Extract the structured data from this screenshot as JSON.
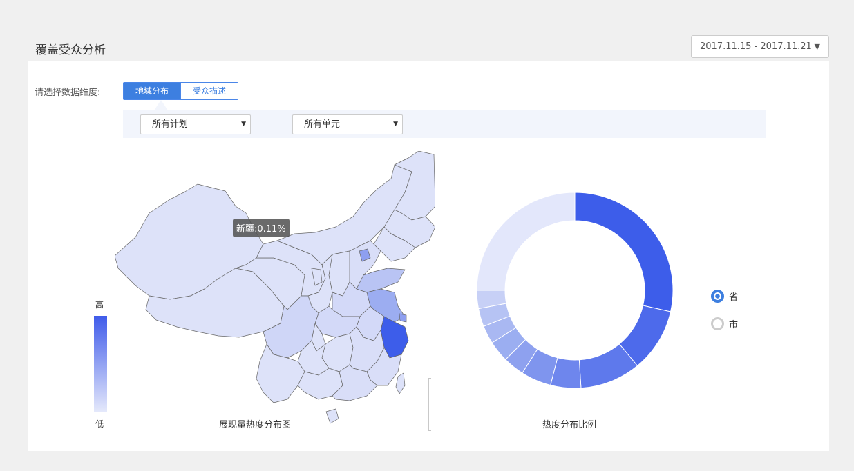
{
  "header": {
    "title": "覆盖受众分析",
    "date_range": "2017.11.15 - 2017.11.21"
  },
  "filters": {
    "dimension_label": "请选择数据维度:",
    "tabs": [
      {
        "label": "地域分布",
        "active": true
      },
      {
        "label": "受众描述",
        "active": false
      }
    ],
    "plan_select": "所有计划",
    "unit_select": "所有单元"
  },
  "map": {
    "legend_high": "高",
    "legend_low": "低",
    "tooltip": "新疆:0.11%",
    "caption": "展现量热度分布图",
    "colors": {
      "high": "#3f5bea",
      "low": "#e4e8fb",
      "stroke": "#666666"
    }
  },
  "donut": {
    "caption": "热度分布比例",
    "slices": [
      {
        "value": 28.5,
        "color": "#3d5dea"
      },
      {
        "value": 10.5,
        "color": "#4d6aeb"
      },
      {
        "value": 10.0,
        "color": "#5e79ec"
      },
      {
        "value": 5.0,
        "color": "#6e86ed"
      },
      {
        "value": 5.0,
        "color": "#7f95ee"
      },
      {
        "value": 3.5,
        "color": "#8ea1ef"
      },
      {
        "value": 3.5,
        "color": "#9baef1"
      },
      {
        "value": 3.0,
        "color": "#a9b8f2"
      },
      {
        "value": 3.0,
        "color": "#b6c3f4"
      },
      {
        "value": 3.0,
        "color": "#c7d0f6"
      },
      {
        "value": 25.0,
        "color": "#e3e7fb"
      }
    ]
  },
  "scope": {
    "options": [
      {
        "label": "省",
        "selected": true
      },
      {
        "label": "市",
        "selected": false
      }
    ]
  }
}
